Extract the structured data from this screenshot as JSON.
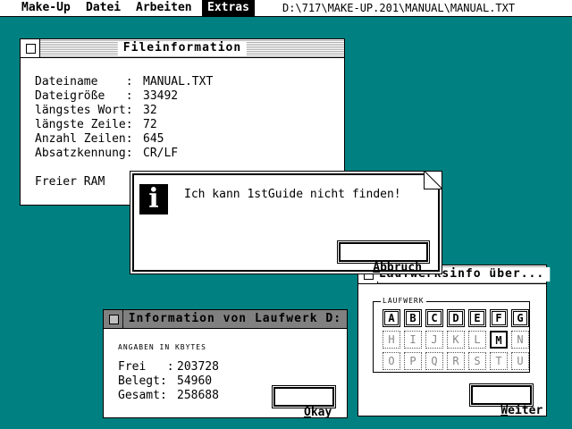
{
  "menubar": {
    "items": [
      "Make-Up",
      "Datei",
      "Arbeiten",
      "Extras"
    ],
    "active": "Extras",
    "path": "D:\\717\\MAKE-UP.201\\MANUAL\\MANUAL.TXT"
  },
  "fileinfo": {
    "title": "Fileinformation",
    "rows": [
      {
        "label": "Dateiname    :",
        "value": "MANUAL.TXT"
      },
      {
        "label": "Dateigröße   :",
        "value": "33492"
      },
      {
        "label": "längstes Wort:",
        "value": "32"
      },
      {
        "label": "längste Zeile:",
        "value": "72"
      },
      {
        "label": "Anzahl Zeilen:",
        "value": "645"
      },
      {
        "label": "Absatzkennung:",
        "value": "CR/LF"
      }
    ],
    "ram_label": "Freier RAM"
  },
  "alert": {
    "message": "Ich kann 1stGuide nicht finden!",
    "button_prefix": "",
    "button_hot": "A",
    "button_rest": "bbruch",
    "icon": "info-icon"
  },
  "driveinfo": {
    "title": "Information von Laufwerk D:",
    "subtitle": "ANGABEN IN KBYTES",
    "rows": [
      {
        "label": "Frei   :",
        "value": "203728"
      },
      {
        "label": "Belegt:",
        "value": "54960"
      },
      {
        "label": "Gesamt:",
        "value": "258688"
      }
    ],
    "button_hot": "O",
    "button_rest": "kay"
  },
  "driveselect": {
    "title": "Laufwerksinfo über...",
    "group_label": "LAUFWERK",
    "rows": [
      [
        {
          "l": "A",
          "s": "active"
        },
        {
          "l": "B",
          "s": "active"
        },
        {
          "l": "C",
          "s": "active"
        },
        {
          "l": "D",
          "s": "active"
        },
        {
          "l": "E",
          "s": "active"
        },
        {
          "l": "F",
          "s": "active"
        },
        {
          "l": "G",
          "s": "active"
        }
      ],
      [
        {
          "l": "H",
          "s": "inactive"
        },
        {
          "l": "I",
          "s": "inactive"
        },
        {
          "l": "J",
          "s": "inactive"
        },
        {
          "l": "K",
          "s": "inactive"
        },
        {
          "l": "L",
          "s": "inactive"
        },
        {
          "l": "M",
          "s": "selected"
        },
        {
          "l": "N",
          "s": "inactive"
        }
      ],
      [
        {
          "l": "O",
          "s": "inactive"
        },
        {
          "l": "P",
          "s": "inactive"
        },
        {
          "l": "Q",
          "s": "inactive"
        },
        {
          "l": "R",
          "s": "inactive"
        },
        {
          "l": "S",
          "s": "inactive"
        },
        {
          "l": "T",
          "s": "inactive"
        },
        {
          "l": "U",
          "s": "inactive"
        }
      ]
    ],
    "button_hot": "W",
    "button_rest": "eiter"
  }
}
